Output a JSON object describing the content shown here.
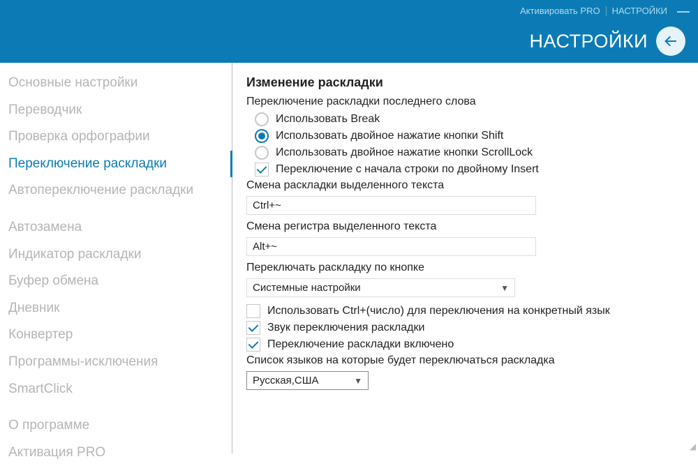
{
  "header": {
    "activate_pro": "Активировать PRO",
    "settings_link": "НАСТРОЙКИ",
    "title": "НАСТРОЙКИ"
  },
  "sidebar": {
    "items": [
      {
        "label": "Основные настройки",
        "active": false
      },
      {
        "label": "Переводчик",
        "active": false
      },
      {
        "label": "Проверка орфографии",
        "active": false
      },
      {
        "label": "Переключение раскладки",
        "active": true
      },
      {
        "label": "Автопереключение раскладки",
        "active": false
      },
      {
        "label": "Автозамена",
        "active": false,
        "gap": true
      },
      {
        "label": "Индикатор раскладки",
        "active": false
      },
      {
        "label": "Буфер обмена",
        "active": false
      },
      {
        "label": "Дневник",
        "active": false
      },
      {
        "label": "Конвертер",
        "active": false
      },
      {
        "label": "Программы-исключения",
        "active": false
      },
      {
        "label": "SmartClick",
        "active": false
      },
      {
        "label": "О программе",
        "active": false,
        "gap": true
      },
      {
        "label": "Активация PRO",
        "active": false
      }
    ]
  },
  "content": {
    "heading": "Изменение раскладки",
    "last_word_label": "Переключение раскладки последнего слова",
    "radios": {
      "use_break": "Использовать Break",
      "use_shift": "Использовать двойное нажатие кнопки Shift",
      "use_scrolllock": "Использовать двойное нажатие кнопки ScrollLock",
      "selected": "use_shift"
    },
    "insert_check": {
      "label": "Переключение с начала строки по двойному Insert",
      "checked": true
    },
    "sel_layout_label": "Смена раскладки выделенного текста",
    "sel_layout_value": "Ctrl+~",
    "sel_case_label": "Смена регистра выделенного текста",
    "sel_case_value": "Alt+~",
    "switch_by_button_label": "Переключать раскладку по кнопке",
    "switch_by_button_value": "Системные настройки",
    "use_ctrl_num": {
      "label": "Использовать Ctrl+(число) для переключения на конкретный язык",
      "checked": false
    },
    "sound": {
      "label": "Звук переключения раскладки",
      "checked": true
    },
    "enabled": {
      "label": "Переключение раскладки включено",
      "checked": true
    },
    "lang_list_label": "Список языков на которые будет переключаться раскладка",
    "lang_list_value": "Русская,США"
  }
}
